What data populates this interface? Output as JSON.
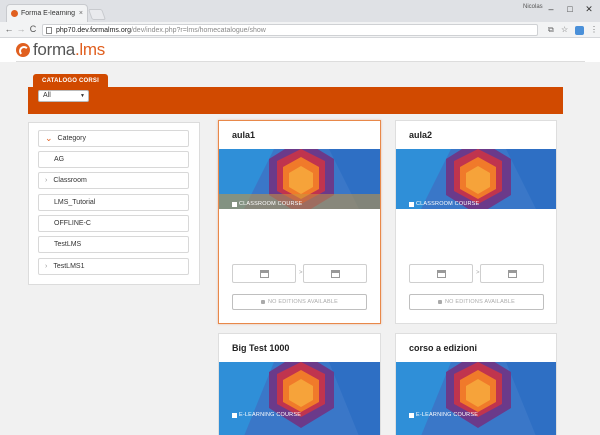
{
  "browser": {
    "tab_title": "Forma E-learning",
    "tab_close": "×",
    "user_name": "Nicolas",
    "controls": {
      "minimize": "–",
      "maximize": "□",
      "close": "✕"
    },
    "nav": {
      "back": "←",
      "forward": "→",
      "reload": "C"
    },
    "url_host": "php70.dev.formalms.org",
    "url_path": "/dev/index.php?r=lms/homecatalogue/show",
    "omni_icons": {
      "translate": "⧉",
      "star": "☆",
      "menu": "⋮"
    }
  },
  "header": {
    "logo_part1": "forma",
    "logo_part2": ".lms"
  },
  "catalogue": {
    "tab_label": "CATALOGO CORSI",
    "filter_value": "All",
    "filter_caret": "▼"
  },
  "sidebar": {
    "heading": "Category",
    "heading_chevron": "⌄",
    "item_chevron": "›",
    "items": [
      {
        "label": "AG"
      },
      {
        "label": "Classroom"
      },
      {
        "label": "LMS_Tutorial"
      },
      {
        "label": "OFFLINE-C"
      },
      {
        "label": "TestLMS"
      },
      {
        "label": "TestLMS1"
      }
    ]
  },
  "courses": [
    {
      "title": "aula1",
      "type_label": "CLASSROOM COURSE",
      "editions_label": "NO EDITIONS AVAILABLE"
    },
    {
      "title": "aula2",
      "type_label": "CLASSROOM COURSE",
      "editions_label": "NO EDITIONS AVAILABLE"
    },
    {
      "title": "Big Test 1000",
      "type_label": "E-LEARNING COURSE"
    },
    {
      "title": "corso a edizioni",
      "type_label": "E-LEARNING COURSE"
    }
  ],
  "date_separator": ">",
  "colors": {
    "brand": "#e05f1f",
    "banner": "#d14a00",
    "card_image_bg": "#3a77c8"
  },
  "icons": {
    "calendar": "calendar-icon",
    "lock": "lock-icon",
    "course_type": "course-type-icon"
  }
}
